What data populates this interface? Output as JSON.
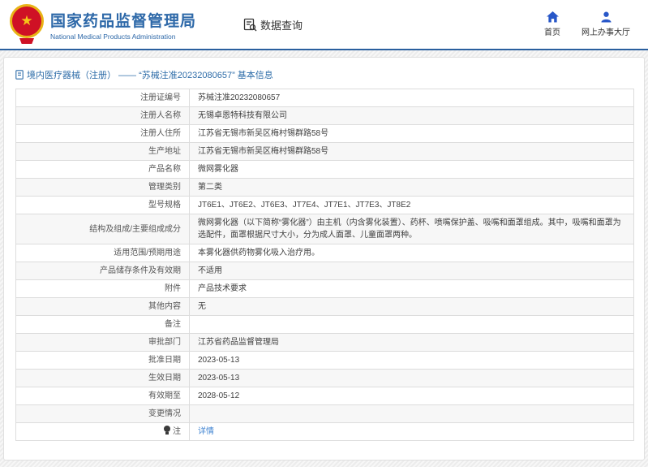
{
  "header": {
    "agency_zh": "国家药品监督管理局",
    "agency_en": "National Medical Products Administration",
    "data_query": "数据查询",
    "home": "首页",
    "online_hall": "网上办事大厅"
  },
  "page": {
    "title": "境内医疗器械（注册） —— “苏械注准20232080657” 基本信息"
  },
  "colors": {
    "brand_blue": "#2d68a8",
    "nav_icon_blue": "#2857c8",
    "link_blue": "#4285d2",
    "emblem_red": "#cf1125",
    "emblem_gold": "#e8b417"
  },
  "table": {
    "rows": [
      {
        "label": "注册证编号",
        "value": "苏械注准20232080657"
      },
      {
        "label": "注册人名称",
        "value": "无锡卓恩特科技有限公司"
      },
      {
        "label": "注册人住所",
        "value": "江苏省无锡市新吴区梅村锡群路58号"
      },
      {
        "label": "生产地址",
        "value": "江苏省无锡市新吴区梅村锡群路58号"
      },
      {
        "label": "产品名称",
        "value": "微网雾化器"
      },
      {
        "label": "管理类别",
        "value": "第二类"
      },
      {
        "label": "型号规格",
        "value": "JT6E1、JT6E2、JT6E3、JT7E4、JT7E1、JT7E3、JT8E2"
      },
      {
        "label": "结构及组成/主要组成成分",
        "value": "微网雾化器（以下简称“雾化器”）由主机（内含雾化装置）、药杯、喷嘴保护盖、吸嘴和面罩组成。其中，吸嘴和面罩为选配件，面罩根据尺寸大小，分为成人面罩、儿童面罩两种。"
      },
      {
        "label": "适用范围/预期用途",
        "value": "本雾化器供药物雾化吸入治疗用。"
      },
      {
        "label": "产品储存条件及有效期",
        "value": "不适用"
      },
      {
        "label": "附件",
        "value": "产品技术要求"
      },
      {
        "label": "其他内容",
        "value": "无"
      },
      {
        "label": "备注",
        "value": ""
      },
      {
        "label": "审批部门",
        "value": "江苏省药品监督管理局"
      },
      {
        "label": "批准日期",
        "value": "2023-05-13"
      },
      {
        "label": "生效日期",
        "value": "2023-05-13"
      },
      {
        "label": "有效期至",
        "value": "2028-05-12"
      },
      {
        "label": "变更情况",
        "value": ""
      },
      {
        "label": "注",
        "value": "详情",
        "value_link": true,
        "label_icon": "note-bulb"
      }
    ]
  }
}
